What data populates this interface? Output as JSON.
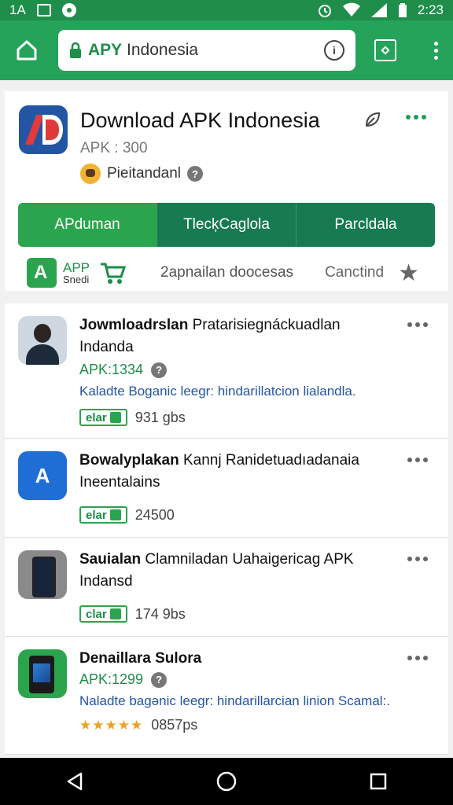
{
  "status_bar": {
    "left_text": "1A",
    "time": "2:23"
  },
  "browser": {
    "url_brand": "APY",
    "url_rest": "Indonesia"
  },
  "header": {
    "title": "Download APK Indonesia",
    "subtitle": "APK : 300",
    "developer": "Pieitandanl",
    "help_badge": "?"
  },
  "tabs": [
    {
      "label": "APduman"
    },
    {
      "label": "TlecķCaglola"
    },
    {
      "label": "Parcldala"
    }
  ],
  "subbar": {
    "app_label": "APP",
    "app_sub": "Snedi",
    "text1": "2apnailan doocesas",
    "text2": "Canctind"
  },
  "items": [
    {
      "title_bold": "Jowmloadrslan",
      "title_rest": " Pratarisiegnáckuadlan Indanda",
      "apk": "APK:1334",
      "badge": "?",
      "desc": "Kaladte Boganic leegr: hindarillatcion lialandla.",
      "pill": "elar",
      "size": "931 ɡbs"
    },
    {
      "title_bold": "Bowalyplakan",
      "title_rest": " Kannj Ranidetuadıadanaia Ineentalains",
      "pill": "elar",
      "size": "24500"
    },
    {
      "title_bold": "Sauialan",
      "title_rest": " Clamniladan Uahaigericag APK Indansd",
      "pill": "clar",
      "size": "174 9bs"
    },
    {
      "title_bold": "Denaillara Sulora",
      "title_rest": "",
      "apk": "APK:1299",
      "badge": "?",
      "desc": "Naladte bagənic leegr: hindarillarcian linion Scamal:.",
      "stars": "★★★★★",
      "size": "0857ps"
    }
  ],
  "icons": {
    "home": "home-icon",
    "lock": "lock-icon",
    "info": "info-icon",
    "tabs": "tabs-icon",
    "menu": "more-vert-icon",
    "leaf": "leaf-icon",
    "cart": "cart-icon",
    "star": "star-icon",
    "back": "back-icon",
    "home_nav": "home-nav-icon",
    "recents": "recents-icon"
  },
  "colors": {
    "primary": "#25a35a",
    "dark_tab": "#177a50",
    "link": "#2455a4"
  }
}
